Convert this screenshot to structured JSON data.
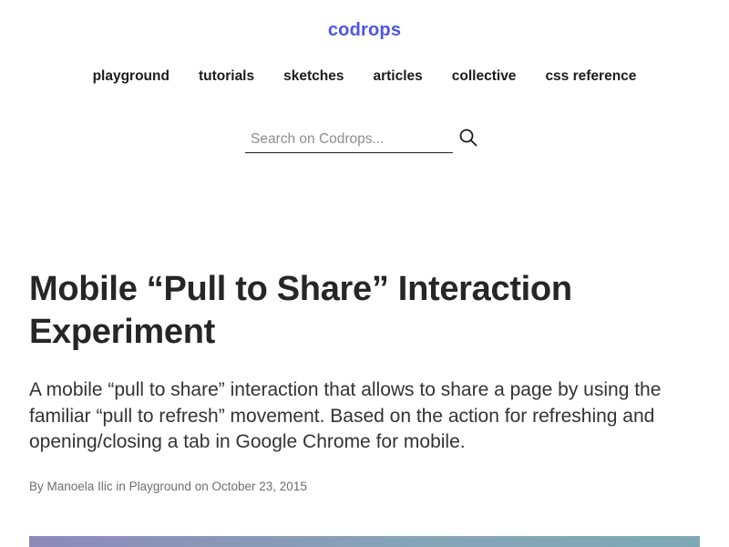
{
  "site": {
    "logo": "codrops",
    "accent_color": "#4c56e6"
  },
  "nav": {
    "items": [
      {
        "label": "playground"
      },
      {
        "label": "tutorials"
      },
      {
        "label": "sketches"
      },
      {
        "label": "articles"
      },
      {
        "label": "collective"
      },
      {
        "label": "css reference"
      }
    ]
  },
  "search": {
    "placeholder": "Search on Codrops...",
    "value": "",
    "icon": "search-icon"
  },
  "article": {
    "title": "Mobile “Pull to Share” Interaction Experiment",
    "excerpt": "A mobile “pull to share” interaction that allows to share a page by using the familiar “pull to refresh” movement. Based on the action for refreshing and opening/closing a tab in Google Chrome for mobile.",
    "byline": {
      "by": "By",
      "author": "Manoela Ilic",
      "in": "in",
      "category": "Playground",
      "on": "on",
      "date": "October 23, 2015"
    }
  }
}
